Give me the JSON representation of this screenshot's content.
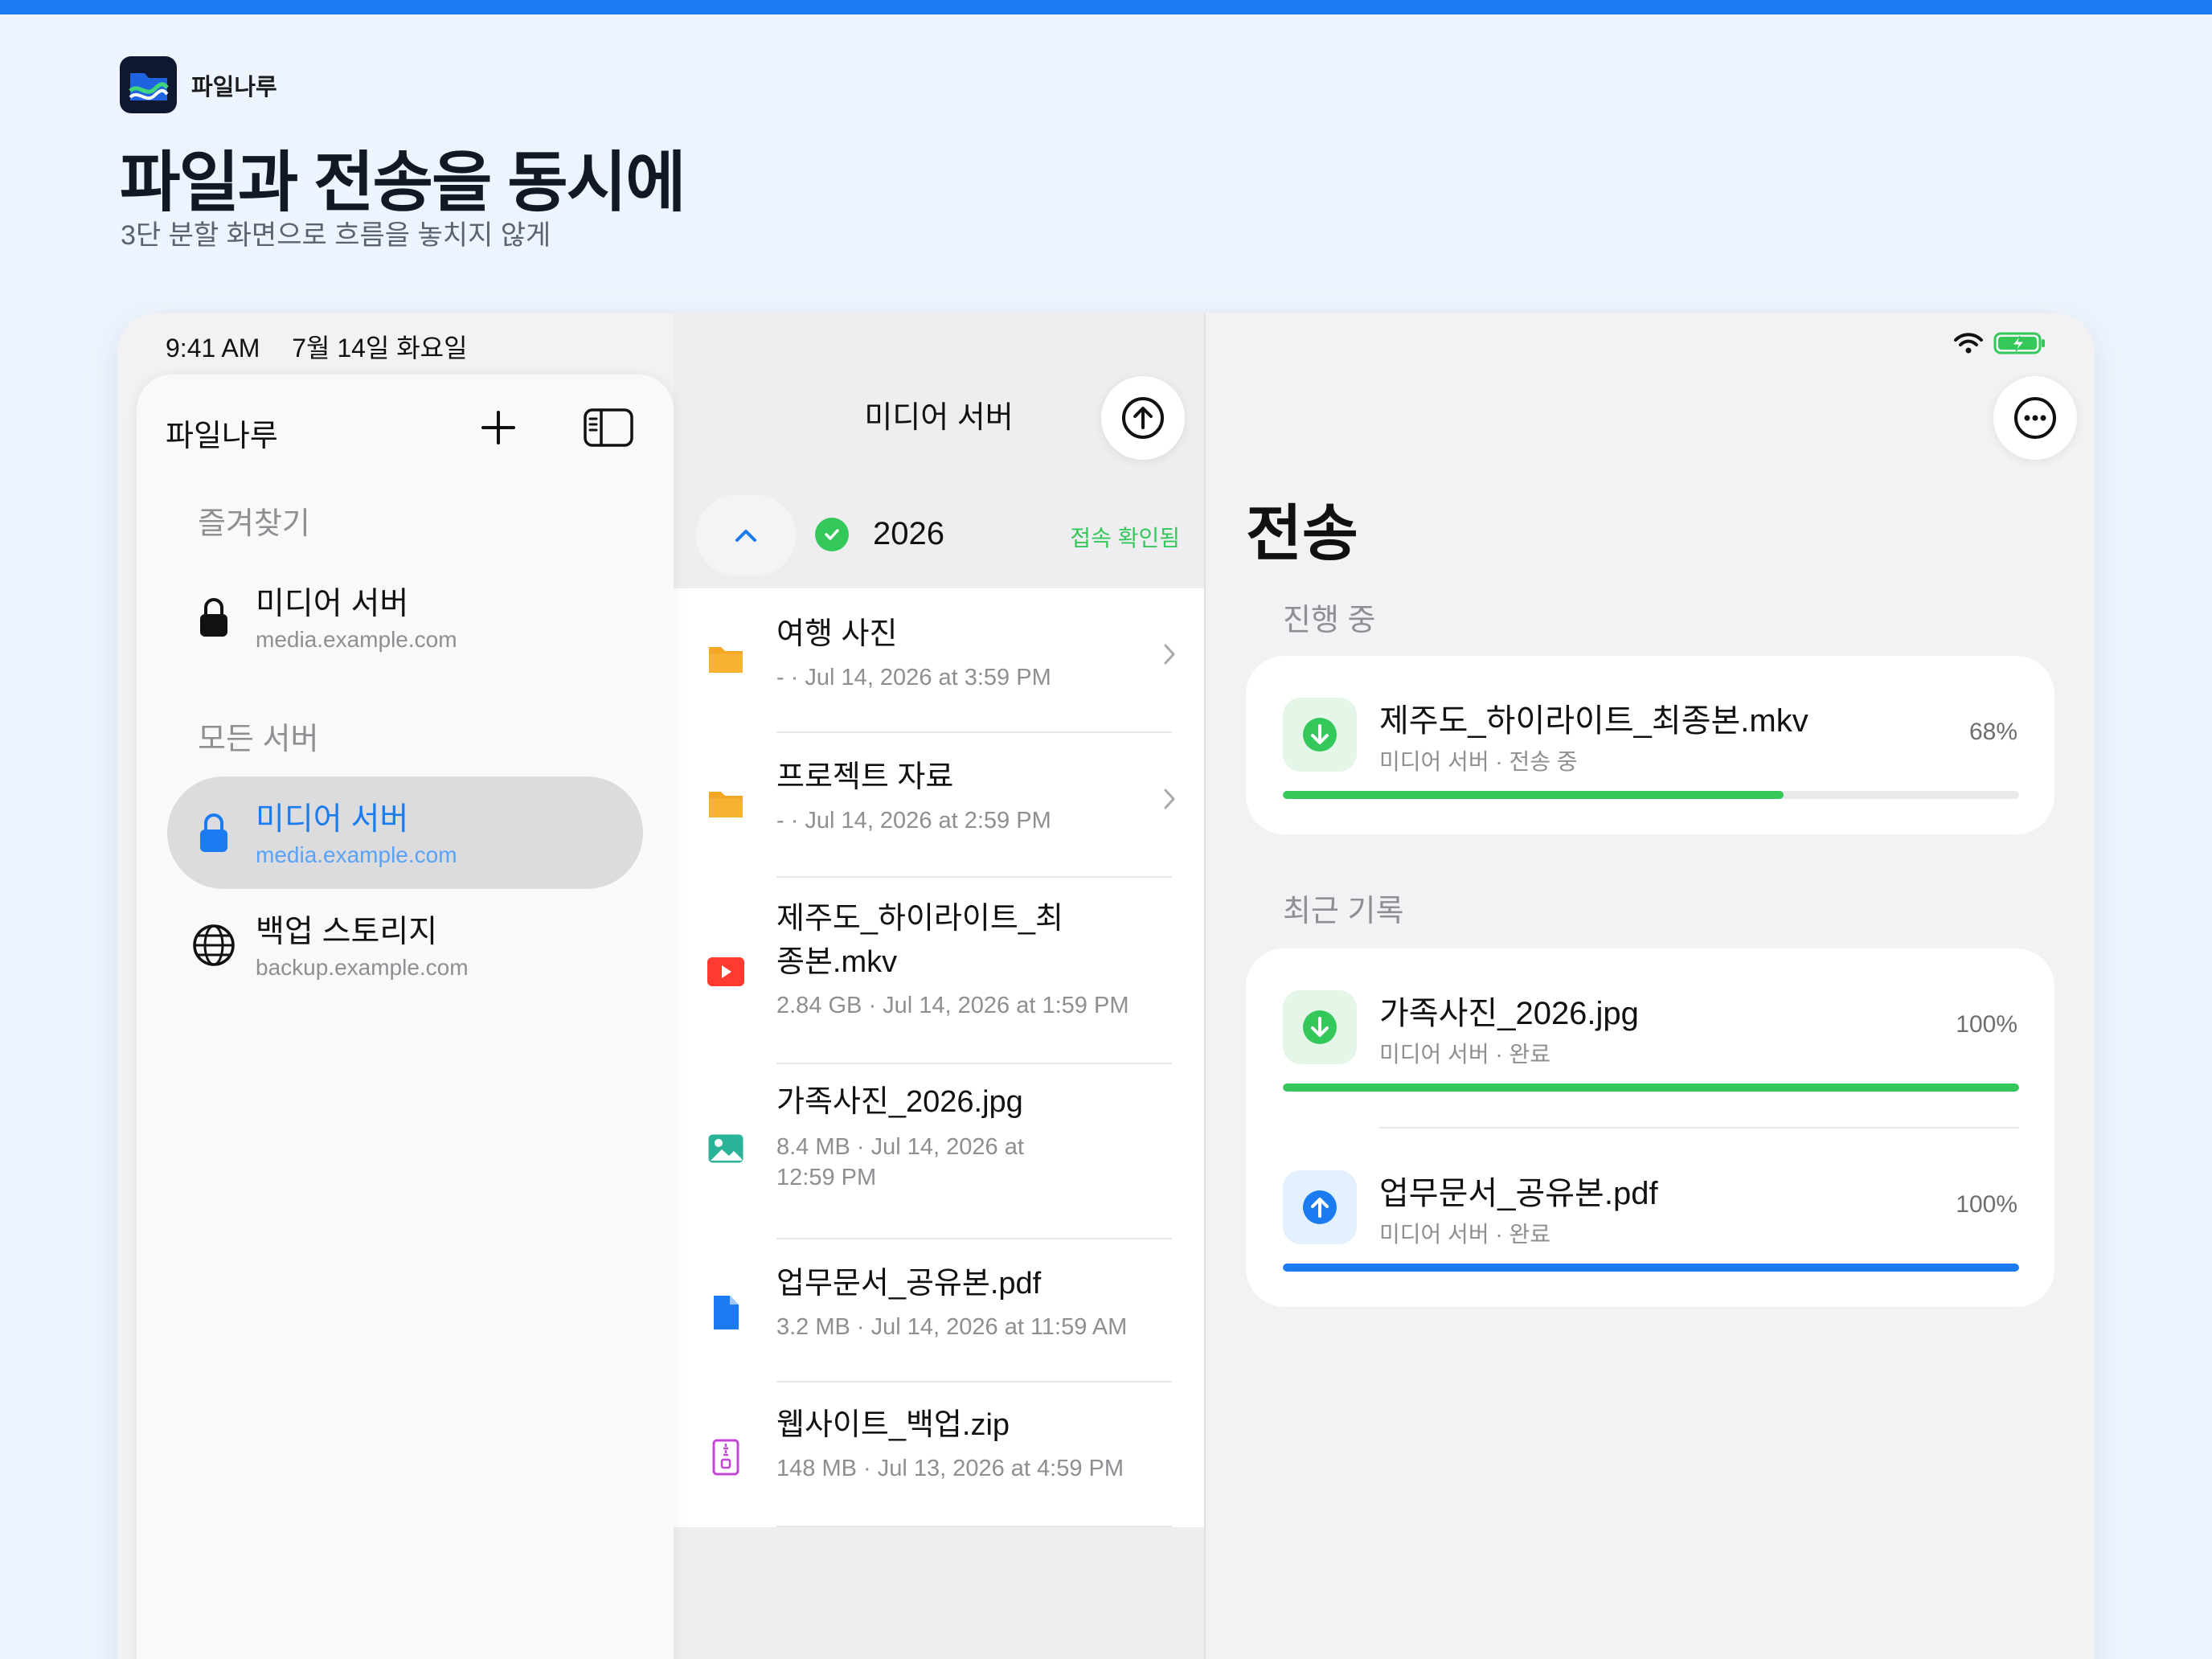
{
  "brand": {
    "name": "파일나루"
  },
  "hero": {
    "title": "파일과 전송을 동시에",
    "subtitle": "3단 분할 화면으로 흐름을 놓치지 않게"
  },
  "status_bar": {
    "time": "9:41 AM",
    "date": "7월 14일 화요일",
    "icons": [
      "wifi-icon",
      "battery-charging-icon"
    ]
  },
  "sidebar": {
    "title": "파일나루",
    "add_icon": "plus-icon",
    "toggle_icon": "sidebar-icon",
    "favorites_label": "즐겨찾기",
    "favorites": [
      {
        "name": "미디어 서버",
        "host": "media.example.com",
        "icon": "lock-icon"
      }
    ],
    "all_servers_label": "모든 서버",
    "servers": [
      {
        "name": "미디어 서버",
        "host": "media.example.com",
        "icon": "lock-icon",
        "selected": true
      },
      {
        "name": "백업 스토리지",
        "host": "backup.example.com",
        "icon": "globe-icon",
        "selected": false
      }
    ]
  },
  "browser": {
    "title": "미디어 서버",
    "upload_icon": "upload-icon",
    "folder": {
      "name": "2026",
      "status": "접속 확인됨"
    },
    "files": [
      {
        "name": "여행 사진",
        "meta": "- · Jul 14, 2026 at 3:59 PM",
        "icon": "folder-icon",
        "type": "folder"
      },
      {
        "name": "프로젝트 자료",
        "meta": "- · Jul 14, 2026 at 2:59 PM",
        "icon": "folder-icon",
        "type": "folder"
      },
      {
        "name": "제주도_하이라이트_최종본.mkv",
        "name_lines": [
          "제주도_하이라이트_최",
          "종본.mkv"
        ],
        "meta": "2.84 GB · Jul 14, 2026 at 1:59 PM",
        "icon": "video-icon",
        "type": "video"
      },
      {
        "name": "가족사진_2026.jpg",
        "meta": "8.4 MB · Jul 14, 2026 at 12:59 PM",
        "meta_lines": [
          "8.4 MB · Jul 14, 2026 at",
          "12:59 PM"
        ],
        "icon": "image-icon",
        "type": "image"
      },
      {
        "name": "업무문서_공유본.pdf",
        "meta": "3.2 MB · Jul 14, 2026 at 11:59 AM",
        "icon": "document-icon",
        "type": "pdf"
      },
      {
        "name": "웹사이트_백업.zip",
        "meta": "148 MB · Jul 13, 2026 at 4:59 PM",
        "icon": "zip-icon",
        "type": "zip"
      }
    ]
  },
  "transfers": {
    "title": "전송",
    "more_icon": "more-icon",
    "in_progress_label": "진행 중",
    "in_progress": [
      {
        "name": "제주도_하이라이트_최종본.mkv",
        "sub": "미디어 서버 · 전송 중",
        "percent_label": "68%",
        "progress": 0.68,
        "direction": "download",
        "color": "#34c759"
      }
    ],
    "recent_label": "최근 기록",
    "recent": [
      {
        "name": "가족사진_2026.jpg",
        "sub": "미디어 서버 · 완료",
        "percent_label": "100%",
        "progress": 1.0,
        "direction": "download",
        "color": "#34c759"
      },
      {
        "name": "업무문서_공유본.pdf",
        "sub": "미디어 서버 · 완료",
        "percent_label": "100%",
        "progress": 1.0,
        "direction": "upload",
        "color": "#1a7cf0"
      }
    ]
  },
  "colors": {
    "accent": "#1a7cf0",
    "success": "#34c759",
    "folder": "#f5a623",
    "video": "#ff3b30",
    "image": "#2bb39a",
    "pdf": "#1a7cf0",
    "zip": "#c644d9"
  }
}
